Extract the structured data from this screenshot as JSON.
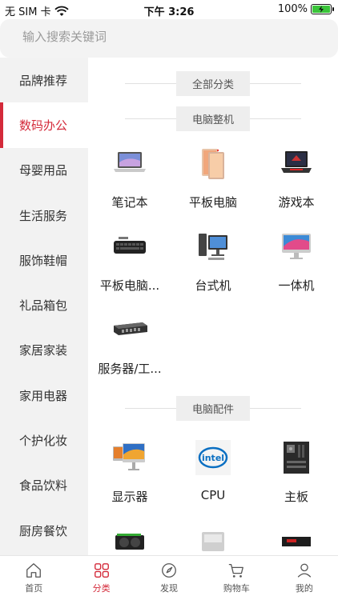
{
  "status_bar": {
    "carrier": "无 SIM 卡",
    "time": "下午 3:26",
    "battery": "100%"
  },
  "search": {
    "placeholder": "输入搜索关键词"
  },
  "sidebar": {
    "items": [
      {
        "label": "品牌推荐"
      },
      {
        "label": "数码办公"
      },
      {
        "label": "母婴用品"
      },
      {
        "label": "生活服务"
      },
      {
        "label": "服饰鞋帽"
      },
      {
        "label": "礼品箱包"
      },
      {
        "label": "家居家装"
      },
      {
        "label": "家用电器"
      },
      {
        "label": "个护化妆"
      },
      {
        "label": "食品饮料"
      },
      {
        "label": "厨房餐饮"
      }
    ]
  },
  "main": {
    "all_label": "全部分类",
    "sections": [
      {
        "title": "电脑整机",
        "items": [
          {
            "label": "笔记本",
            "icon": "laptop-icon"
          },
          {
            "label": "平板电脑",
            "icon": "tablet-icon"
          },
          {
            "label": "游戏本",
            "icon": "gaming-laptop-icon"
          },
          {
            "label": "平板电脑...",
            "icon": "keyboard-icon"
          },
          {
            "label": "台式机",
            "icon": "desktop-icon"
          },
          {
            "label": "一体机",
            "icon": "all-in-one-icon"
          },
          {
            "label": "服务器/工...",
            "icon": "server-icon"
          }
        ]
      },
      {
        "title": "电脑配件",
        "items": [
          {
            "label": "显示器",
            "icon": "monitor-icon"
          },
          {
            "label": "CPU",
            "icon": "cpu-icon"
          },
          {
            "label": "主板",
            "icon": "motherboard-icon"
          },
          {
            "label": "",
            "icon": "graphics-card-icon"
          },
          {
            "label": "",
            "icon": "hard-drive-icon"
          },
          {
            "label": "",
            "icon": "memory-icon"
          }
        ]
      }
    ]
  },
  "tabbar": {
    "items": [
      {
        "label": "首页",
        "icon": "home-icon"
      },
      {
        "label": "分类",
        "icon": "category-icon"
      },
      {
        "label": "发现",
        "icon": "discover-icon"
      },
      {
        "label": "购物车",
        "icon": "cart-icon"
      },
      {
        "label": "我的",
        "icon": "user-icon"
      }
    ]
  },
  "colors": {
    "accent": "#d42a3a",
    "sidebar_bg": "#f2f2f2",
    "battery": "#3ac43a"
  }
}
